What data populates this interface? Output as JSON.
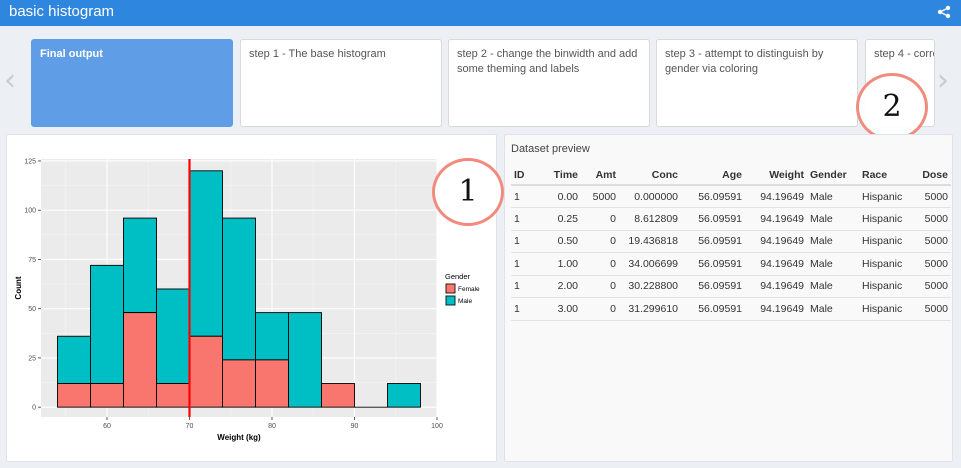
{
  "app": {
    "title": "basic histogram",
    "share_icon": "share-icon"
  },
  "steps": [
    {
      "label": "Final output",
      "active": true
    },
    {
      "label": "step 1 - The base histogram",
      "active": false
    },
    {
      "label": "step 2 - change the binwidth and add some theming and labels",
      "active": false
    },
    {
      "label": "step 3 - attempt to distinguish by gender via coloring",
      "active": false
    },
    {
      "label": "step 4 - corre",
      "active": false
    }
  ],
  "annotations": {
    "one": "1",
    "two": "2"
  },
  "colors": {
    "female": "#f8766d",
    "male": "#00bfc4",
    "vline": "#ff0000",
    "panel_bg": "#ebebeb",
    "accent": "#2e86de"
  },
  "chart_data": {
    "type": "bar",
    "stacked": true,
    "bin_width": 4,
    "bin_centers": [
      56,
      60,
      64,
      68,
      72,
      76,
      80,
      84,
      88,
      92,
      96
    ],
    "series": [
      {
        "name": "Female",
        "values": [
          12,
          12,
          48,
          12,
          36,
          24,
          24,
          0,
          12,
          0,
          0
        ]
      },
      {
        "name": "Male",
        "values": [
          24,
          60,
          48,
          48,
          84,
          72,
          24,
          48,
          0,
          0,
          12
        ]
      }
    ],
    "vline_x": 70,
    "xlabel": "Weight (kg)",
    "ylabel": "Count",
    "xlim": [
      52,
      100
    ],
    "ylim": [
      -5,
      126
    ],
    "x_ticks": [
      60,
      70,
      80,
      90,
      100
    ],
    "y_ticks": [
      0,
      25,
      50,
      75,
      100,
      125
    ],
    "legend_title": "Gender",
    "legend_position": "right",
    "grid": true
  },
  "table": {
    "title": "Dataset preview",
    "columns": [
      "ID",
      "Time",
      "Amt",
      "Conc",
      "Age",
      "Weight",
      "Gender",
      "Race",
      "Dose"
    ],
    "rows": [
      [
        "1",
        "0.00",
        "5000",
        "0.000000",
        "56.09591",
        "94.19649",
        "Male",
        "Hispanic",
        "5000"
      ],
      [
        "1",
        "0.25",
        "0",
        "8.612809",
        "56.09591",
        "94.19649",
        "Male",
        "Hispanic",
        "5000"
      ],
      [
        "1",
        "0.50",
        "0",
        "19.436818",
        "56.09591",
        "94.19649",
        "Male",
        "Hispanic",
        "5000"
      ],
      [
        "1",
        "1.00",
        "0",
        "34.006699",
        "56.09591",
        "94.19649",
        "Male",
        "Hispanic",
        "5000"
      ],
      [
        "1",
        "2.00",
        "0",
        "30.228800",
        "56.09591",
        "94.19649",
        "Male",
        "Hispanic",
        "5000"
      ],
      [
        "1",
        "3.00",
        "0",
        "31.299610",
        "56.09591",
        "94.19649",
        "Male",
        "Hispanic",
        "5000"
      ]
    ]
  }
}
